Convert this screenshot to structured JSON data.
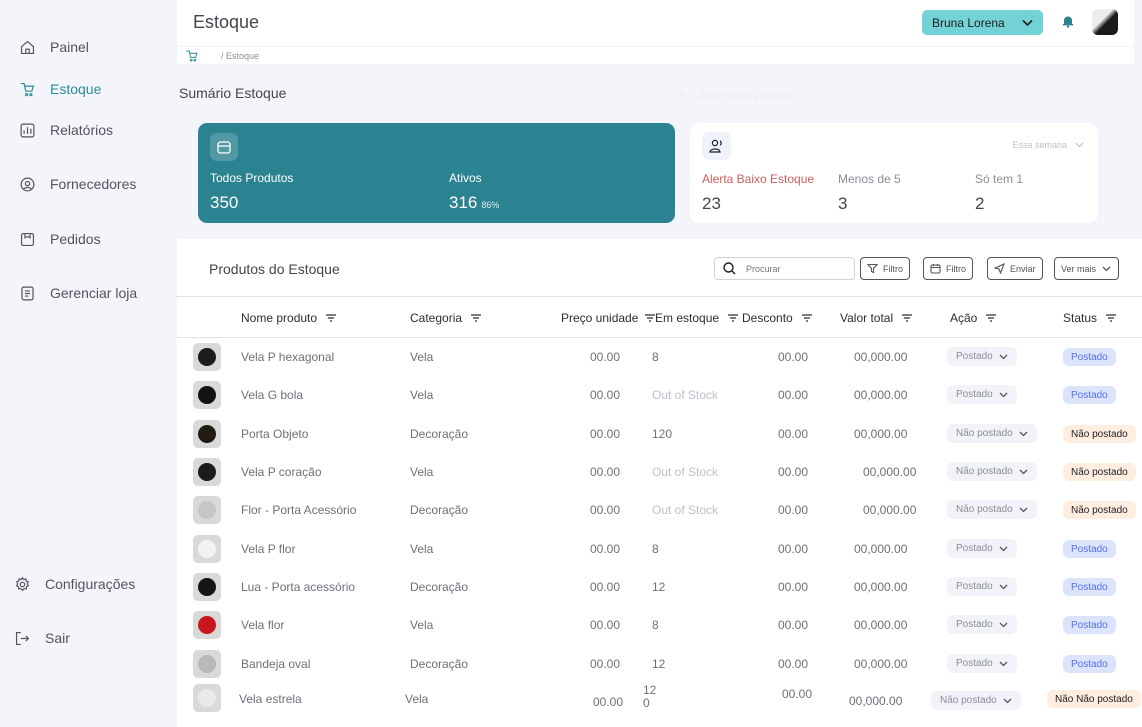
{
  "sidebar": {
    "items": [
      {
        "label": "Painel",
        "icon": "home-icon"
      },
      {
        "label": "Estoque",
        "icon": "tag-icon"
      },
      {
        "label": "Relatórios",
        "icon": "chart-icon"
      },
      {
        "label": "Fornecedores",
        "icon": "user-circle-icon"
      },
      {
        "label": "Pedidos",
        "icon": "bag-icon"
      },
      {
        "label": "Gerenciar loja",
        "icon": "store-icon"
      }
    ],
    "settings_label": "Configurações",
    "logout_label": "Sair"
  },
  "header": {
    "title": "Estoque",
    "user_name": "Bruna Lorena",
    "breadcrumb": "/ Estoque"
  },
  "summary": {
    "title": "Sumário Estoque",
    "add_label": "Add Novo Produto",
    "all_products_label": "Todos Produtos",
    "all_products_value": "350",
    "active_label": "Ativos",
    "active_value": "316",
    "active_pct": "86%",
    "period": "Essa semana",
    "low_stock_label": "Alerta Baixo Estoque",
    "low_stock_value": "23",
    "less5_label": "Menos de 5",
    "less5_value": "3",
    "only1_label": "Só tem 1",
    "only1_value": "2"
  },
  "table": {
    "title": "Produtos do Estoque",
    "search_placeholder": "Procurar",
    "filter_label": "Filtro",
    "filter2_label": "Filtro",
    "send_label": "Enviar",
    "more_label": "Ver mais",
    "headers": {
      "name": "Nome produto",
      "category": "Categoria",
      "price": "Preço unidade",
      "stock": "Em estoque",
      "discount": "Desconto",
      "total": "Valor total",
      "action": "Ação",
      "status": "Status"
    },
    "rows": [
      {
        "name": "Vela  P  hexagonal",
        "category": "Vela",
        "price": "00.00",
        "stock": "8",
        "discount": "00.00",
        "total": "00,000.00",
        "action": "Postado",
        "status": "Postado",
        "thumb": "#1d1d1d"
      },
      {
        "name": "Vela G bola",
        "category": "Vela",
        "price": "00.00",
        "stock": "Out of Stock",
        "discount": "00.00",
        "total": "00,000.00",
        "action": "Postado",
        "status": "Postado",
        "thumb": "#121212"
      },
      {
        "name": "Porta Objeto",
        "category": "Decoração",
        "price": "00.00",
        "stock": "120",
        "discount": "00.00",
        "total": "00,000.00",
        "action": "Não postado",
        "status": "Não postado",
        "thumb": "#201c14"
      },
      {
        "name": "Vela P coração",
        "category": "Vela",
        "price": "00.00",
        "stock": "Out of Stock",
        "discount": "00.00",
        "total": "00,000.00",
        "action": "Não postado",
        "status": "Não postado",
        "thumb": "#1b1b1b"
      },
      {
        "name": "Flor - Porta Acessório",
        "category": "Decoração",
        "price": "00.00",
        "stock": "Out of Stock",
        "discount": "00.00",
        "total": "00,000.00",
        "action": "Não postado",
        "status": "Não postado",
        "thumb": "#c4c6c8"
      },
      {
        "name": "Vela  P flor",
        "category": "Vela",
        "price": "00.00",
        "stock": "8",
        "discount": "00.00",
        "total": "00,000.00",
        "action": "Postado",
        "status": "Postado",
        "thumb": "#f2f2f2"
      },
      {
        "name": "Lua - Porta acessório",
        "category": "Decoração",
        "price": "00.00",
        "stock": "12",
        "discount": "00.00",
        "total": "00,000.00",
        "action": "Postado",
        "status": "Postado",
        "thumb": "#161616"
      },
      {
        "name": "Vela flor",
        "category": "Vela",
        "price": "00.00",
        "stock": "8",
        "discount": "00.00",
        "total": "00,000.00",
        "action": "Postado",
        "status": "Postado",
        "thumb": "#c7171c"
      },
      {
        "name": "Bandeja oval",
        "category": "Decoração",
        "price": "00.00",
        "stock": "12",
        "discount": "00.00",
        "total": "00,000.00",
        "action": "Postado",
        "status": "Postado",
        "thumb": "#b9b9b5"
      },
      {
        "name": "Vela estrela",
        "category": "Vela",
        "price": "00.00",
        "stock": "12",
        "stock2": "0",
        "discount": "00.00",
        "total": "00,000.00",
        "action": "Não postado",
        "status": "Não Não postado",
        "thumb": "#e9e9e9"
      }
    ]
  },
  "colors": {
    "accent": "#2b8290",
    "user_pill": "#73d2d6",
    "posted_bg": "#dbe4fb",
    "not_posted_bg": "#feeee0"
  }
}
